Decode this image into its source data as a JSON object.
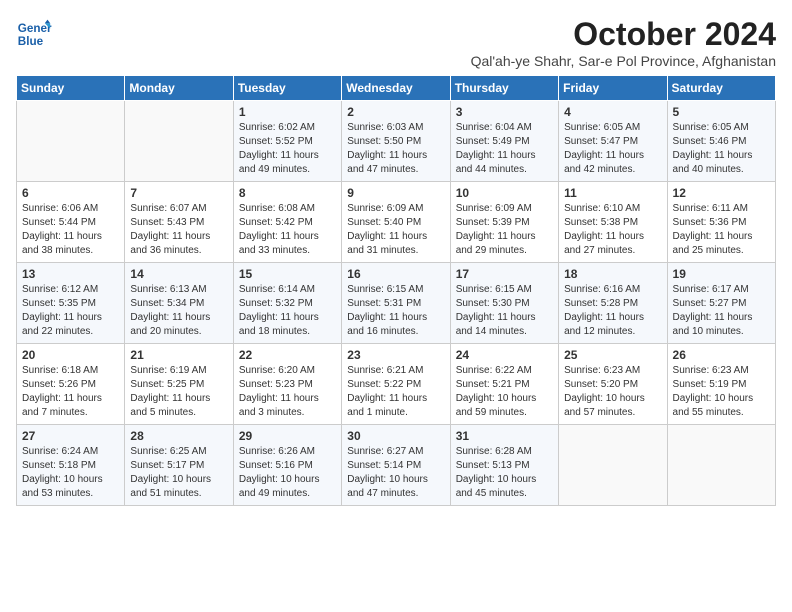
{
  "logo": {
    "line1": "General",
    "line2": "Blue"
  },
  "title": "October 2024",
  "subtitle": "Qal'ah-ye Shahr, Sar-e Pol Province, Afghanistan",
  "weekdays": [
    "Sunday",
    "Monday",
    "Tuesday",
    "Wednesday",
    "Thursday",
    "Friday",
    "Saturday"
  ],
  "weeks": [
    [
      {
        "day": "",
        "detail": ""
      },
      {
        "day": "",
        "detail": ""
      },
      {
        "day": "1",
        "detail": "Sunrise: 6:02 AM\nSunset: 5:52 PM\nDaylight: 11 hours and 49 minutes."
      },
      {
        "day": "2",
        "detail": "Sunrise: 6:03 AM\nSunset: 5:50 PM\nDaylight: 11 hours and 47 minutes."
      },
      {
        "day": "3",
        "detail": "Sunrise: 6:04 AM\nSunset: 5:49 PM\nDaylight: 11 hours and 44 minutes."
      },
      {
        "day": "4",
        "detail": "Sunrise: 6:05 AM\nSunset: 5:47 PM\nDaylight: 11 hours and 42 minutes."
      },
      {
        "day": "5",
        "detail": "Sunrise: 6:05 AM\nSunset: 5:46 PM\nDaylight: 11 hours and 40 minutes."
      }
    ],
    [
      {
        "day": "6",
        "detail": "Sunrise: 6:06 AM\nSunset: 5:44 PM\nDaylight: 11 hours and 38 minutes."
      },
      {
        "day": "7",
        "detail": "Sunrise: 6:07 AM\nSunset: 5:43 PM\nDaylight: 11 hours and 36 minutes."
      },
      {
        "day": "8",
        "detail": "Sunrise: 6:08 AM\nSunset: 5:42 PM\nDaylight: 11 hours and 33 minutes."
      },
      {
        "day": "9",
        "detail": "Sunrise: 6:09 AM\nSunset: 5:40 PM\nDaylight: 11 hours and 31 minutes."
      },
      {
        "day": "10",
        "detail": "Sunrise: 6:09 AM\nSunset: 5:39 PM\nDaylight: 11 hours and 29 minutes."
      },
      {
        "day": "11",
        "detail": "Sunrise: 6:10 AM\nSunset: 5:38 PM\nDaylight: 11 hours and 27 minutes."
      },
      {
        "day": "12",
        "detail": "Sunrise: 6:11 AM\nSunset: 5:36 PM\nDaylight: 11 hours and 25 minutes."
      }
    ],
    [
      {
        "day": "13",
        "detail": "Sunrise: 6:12 AM\nSunset: 5:35 PM\nDaylight: 11 hours and 22 minutes."
      },
      {
        "day": "14",
        "detail": "Sunrise: 6:13 AM\nSunset: 5:34 PM\nDaylight: 11 hours and 20 minutes."
      },
      {
        "day": "15",
        "detail": "Sunrise: 6:14 AM\nSunset: 5:32 PM\nDaylight: 11 hours and 18 minutes."
      },
      {
        "day": "16",
        "detail": "Sunrise: 6:15 AM\nSunset: 5:31 PM\nDaylight: 11 hours and 16 minutes."
      },
      {
        "day": "17",
        "detail": "Sunrise: 6:15 AM\nSunset: 5:30 PM\nDaylight: 11 hours and 14 minutes."
      },
      {
        "day": "18",
        "detail": "Sunrise: 6:16 AM\nSunset: 5:28 PM\nDaylight: 11 hours and 12 minutes."
      },
      {
        "day": "19",
        "detail": "Sunrise: 6:17 AM\nSunset: 5:27 PM\nDaylight: 11 hours and 10 minutes."
      }
    ],
    [
      {
        "day": "20",
        "detail": "Sunrise: 6:18 AM\nSunset: 5:26 PM\nDaylight: 11 hours and 7 minutes."
      },
      {
        "day": "21",
        "detail": "Sunrise: 6:19 AM\nSunset: 5:25 PM\nDaylight: 11 hours and 5 minutes."
      },
      {
        "day": "22",
        "detail": "Sunrise: 6:20 AM\nSunset: 5:23 PM\nDaylight: 11 hours and 3 minutes."
      },
      {
        "day": "23",
        "detail": "Sunrise: 6:21 AM\nSunset: 5:22 PM\nDaylight: 11 hours and 1 minute."
      },
      {
        "day": "24",
        "detail": "Sunrise: 6:22 AM\nSunset: 5:21 PM\nDaylight: 10 hours and 59 minutes."
      },
      {
        "day": "25",
        "detail": "Sunrise: 6:23 AM\nSunset: 5:20 PM\nDaylight: 10 hours and 57 minutes."
      },
      {
        "day": "26",
        "detail": "Sunrise: 6:23 AM\nSunset: 5:19 PM\nDaylight: 10 hours and 55 minutes."
      }
    ],
    [
      {
        "day": "27",
        "detail": "Sunrise: 6:24 AM\nSunset: 5:18 PM\nDaylight: 10 hours and 53 minutes."
      },
      {
        "day": "28",
        "detail": "Sunrise: 6:25 AM\nSunset: 5:17 PM\nDaylight: 10 hours and 51 minutes."
      },
      {
        "day": "29",
        "detail": "Sunrise: 6:26 AM\nSunset: 5:16 PM\nDaylight: 10 hours and 49 minutes."
      },
      {
        "day": "30",
        "detail": "Sunrise: 6:27 AM\nSunset: 5:14 PM\nDaylight: 10 hours and 47 minutes."
      },
      {
        "day": "31",
        "detail": "Sunrise: 6:28 AM\nSunset: 5:13 PM\nDaylight: 10 hours and 45 minutes."
      },
      {
        "day": "",
        "detail": ""
      },
      {
        "day": "",
        "detail": ""
      }
    ]
  ]
}
